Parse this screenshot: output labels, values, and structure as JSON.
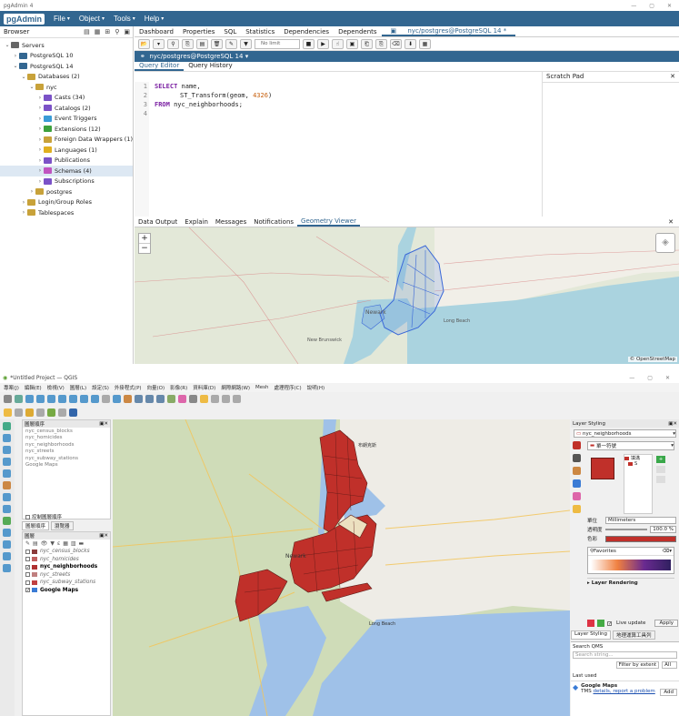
{
  "pgadmin": {
    "window_title": "pgAdmin 4",
    "logo": "pgAdmin",
    "menu": [
      "File",
      "Object",
      "Tools",
      "Help"
    ],
    "browser_label": "Browser",
    "tree": [
      {
        "label": "Servers",
        "level": 0,
        "expanded": true,
        "color": "#666666"
      },
      {
        "label": "PostgreSQL 10",
        "level": 1,
        "expanded": false,
        "color": "#336791"
      },
      {
        "label": "PostgreSQL 14",
        "level": 1,
        "expanded": true,
        "color": "#336791"
      },
      {
        "label": "Databases (2)",
        "level": 2,
        "expanded": true,
        "color": "#c8a23a"
      },
      {
        "label": "nyc",
        "level": 3,
        "expanded": true,
        "color": "#c8a23a"
      },
      {
        "label": "Casts (34)",
        "level": 4,
        "expanded": false,
        "color": "#7b52c7"
      },
      {
        "label": "Catalogs (2)",
        "level": 4,
        "expanded": false,
        "color": "#7b52c7"
      },
      {
        "label": "Event Triggers",
        "level": 4,
        "expanded": false,
        "color": "#3a9bd6"
      },
      {
        "label": "Extensions (12)",
        "level": 4,
        "expanded": false,
        "color": "#3da13d"
      },
      {
        "label": "Foreign Data Wrappers (1)",
        "level": 4,
        "expanded": false,
        "color": "#c8a23a"
      },
      {
        "label": "Languages (1)",
        "level": 4,
        "expanded": false,
        "color": "#e0b020"
      },
      {
        "label": "Publications",
        "level": 4,
        "expanded": false,
        "color": "#7b52c7"
      },
      {
        "label": "Schemas (4)",
        "level": 4,
        "expanded": false,
        "color": "#c054c0",
        "selected": true
      },
      {
        "label": "Subscriptions",
        "level": 4,
        "expanded": false,
        "color": "#7b52c7"
      },
      {
        "label": "postgres",
        "level": 3,
        "expanded": false,
        "color": "#c8a23a"
      },
      {
        "label": "Login/Group Roles",
        "level": 2,
        "expanded": false,
        "color": "#c8a23a"
      },
      {
        "label": "Tablespaces",
        "level": 2,
        "expanded": false,
        "color": "#c8a23a"
      }
    ],
    "tabs": [
      "Dashboard",
      "Properties",
      "SQL",
      "Statistics",
      "Dependencies",
      "Dependents",
      "nyc/postgres@PostgreSQL 14 *"
    ],
    "no_limit": "No limit",
    "connection": "nyc/postgres@PostgreSQL 14",
    "query_tabs": [
      "Query Editor",
      "Query History"
    ],
    "scratch_pad": "Scratch Pad",
    "line_numbers": [
      "1",
      "2",
      "3",
      "4"
    ],
    "code": {
      "l1_kw": "SELECT",
      "l1_rest": " name,",
      "l2_fn": "ST_Transform(geom, ",
      "l2_num": "4326",
      "l2_end": ")",
      "l3_kw": "FROM",
      "l3_rest": " nyc_neighborhoods;"
    },
    "result_tabs": [
      "Data Output",
      "Explain",
      "Messages",
      "Notifications",
      "Geometry Viewer"
    ],
    "zoom_in": "+",
    "zoom_out": "−",
    "attribution": "© OpenStreetMap",
    "map_labels": {
      "newark": "Newark",
      "long_beach": "Long Beach",
      "new_brunswick": "New Brunswick"
    }
  },
  "qgis": {
    "window_title": "*Untitled Project — QGIS",
    "menu": [
      "專案(J)",
      "編輯(E)",
      "檢視(V)",
      "圖層(L)",
      "設定(S)",
      "外掛程式(P)",
      "向量(O)",
      "影像(R)",
      "資料庫(D)",
      "網際網路(W)",
      "Mesh",
      "處理程序(C)",
      "說明(H)"
    ],
    "layer_order_title": "圖層順序",
    "layer_order": [
      "nyc_census_blocks",
      "nyc_homicides",
      "nyc_neighborhoods",
      "nyc_streets",
      "nyc_subway_stations",
      "Google Maps"
    ],
    "control_label": "控制圖層順序",
    "tabs_small": [
      "圖層順序",
      "瀏覽器"
    ],
    "layers_title": "圖層",
    "layers": [
      {
        "name": "nyc_census_blocks",
        "checked": false,
        "color": "#8a3b3b"
      },
      {
        "name": "nyc_homicides",
        "checked": false,
        "color": "#c06060"
      },
      {
        "name": "nyc_neighborhoods",
        "checked": true,
        "color": "#b03030",
        "bold": true
      },
      {
        "name": "nyc_streets",
        "checked": false,
        "color": "#c08080"
      },
      {
        "name": "nyc_subway_stations",
        "checked": false,
        "color": "#c04040"
      },
      {
        "name": "Google Maps",
        "checked": true,
        "color": "#3a7bd5",
        "bold": true
      }
    ],
    "styling": {
      "title": "Layer Styling",
      "layer": "nyc_neighborhoods",
      "mode": "單一符號",
      "symbol_items": [
        "填滿",
        "S"
      ],
      "unit_label": "單位",
      "unit": "Millimeters",
      "opacity_label": "透明度",
      "opacity": "100.0 %",
      "color_label": "色彩",
      "fill_color": "#c0302a",
      "favorites": "Favorites",
      "layer_rendering": "Layer Rendering",
      "live_update": "Live update",
      "apply": "Apply",
      "tab1": "Layer Styling",
      "tab2": "地理運算工具列",
      "search_qms": "Search QMS",
      "search_ph": "Search string...",
      "filter": "Filter by extent",
      "all": "All",
      "last_used": "Last used",
      "gm_name": "Google Maps",
      "gm_desc": "TMS",
      "gm_link": "details, report a problem",
      "add": "Add"
    },
    "map_labels": {
      "newark": "Newark",
      "long_beach": "Long Beach",
      "bronx": "布朗克斯"
    }
  }
}
